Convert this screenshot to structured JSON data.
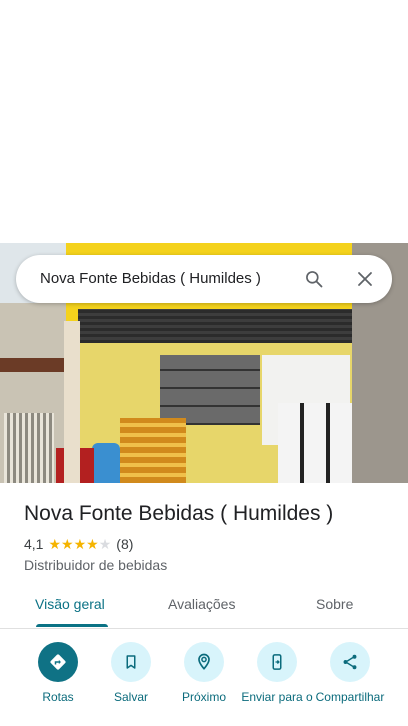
{
  "search": {
    "query": "Nova Fonte Bebidas ( Humildes )",
    "search_icon": "search-icon",
    "close_icon": "close-icon"
  },
  "place": {
    "name": "Nova Fonte Bebidas ( Humildes )",
    "rating": "4,1",
    "rating_value": 4.1,
    "stars_max": 5,
    "review_count": "(8)",
    "category": "Distribuidor de bebidas"
  },
  "tabs": [
    {
      "label": "Visão geral",
      "active": true
    },
    {
      "label": "Avaliações",
      "active": false
    },
    {
      "label": "Sobre",
      "active": false
    }
  ],
  "actions": [
    {
      "label": "Rotas",
      "icon": "directions-icon"
    },
    {
      "label": "Salvar",
      "icon": "bookmark-icon"
    },
    {
      "label": "Próximo",
      "icon": "nearby-icon"
    },
    {
      "label": "Enviar para o",
      "icon": "send-to-phone-icon"
    },
    {
      "label": "Compartilhar",
      "icon": "share-icon"
    }
  ],
  "colors": {
    "accent": "#0b7285",
    "star": "#f5b400",
    "action_bg": "#d8f4fb"
  }
}
